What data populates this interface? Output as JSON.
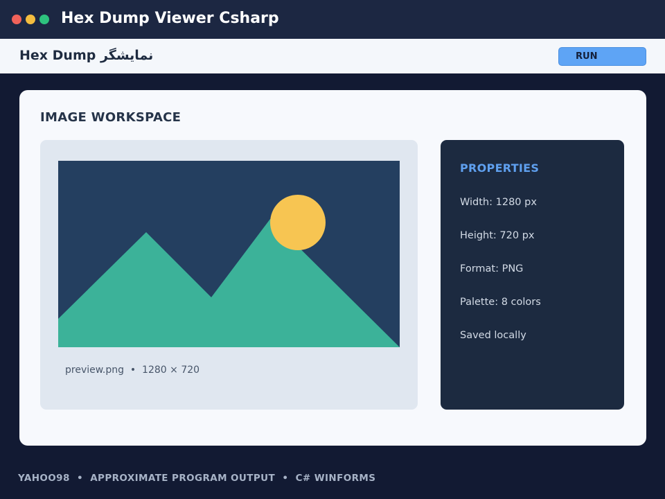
{
  "window": {
    "title": "Hex Dump Viewer Csharp",
    "controls": [
      {
        "icon": "close-dot",
        "color": "#f0625a"
      },
      {
        "icon": "minimize-dot",
        "color": "#f4bd3f"
      },
      {
        "icon": "maximize-dot",
        "color": "#2ec27e"
      }
    ]
  },
  "toolbar": {
    "title": "Hex Dump نمایشگر",
    "run_label": "RUN"
  },
  "workspace": {
    "heading": "IMAGE WORKSPACE",
    "preview": {
      "image_icon": "landscape-image",
      "caption": "preview.png  •  1280 × 720",
      "colors": {
        "sky": "#243f60",
        "mountains": "#3cb299",
        "sun": "#f7c552"
      }
    },
    "properties": {
      "heading": "PROPERTIES",
      "items": [
        "Width: 1280 px",
        "Height: 720 px",
        "Format: PNG",
        "Palette: 8 colors",
        "Saved locally"
      ]
    }
  },
  "footer": {
    "text": "YAHOO98  •  APPROXIMATE PROGRAM OUTPUT  •  C# WINFORMS"
  },
  "colors": {
    "background": "#121a33",
    "titlebar": "#1c2742",
    "accent": "#5ea4f5"
  }
}
